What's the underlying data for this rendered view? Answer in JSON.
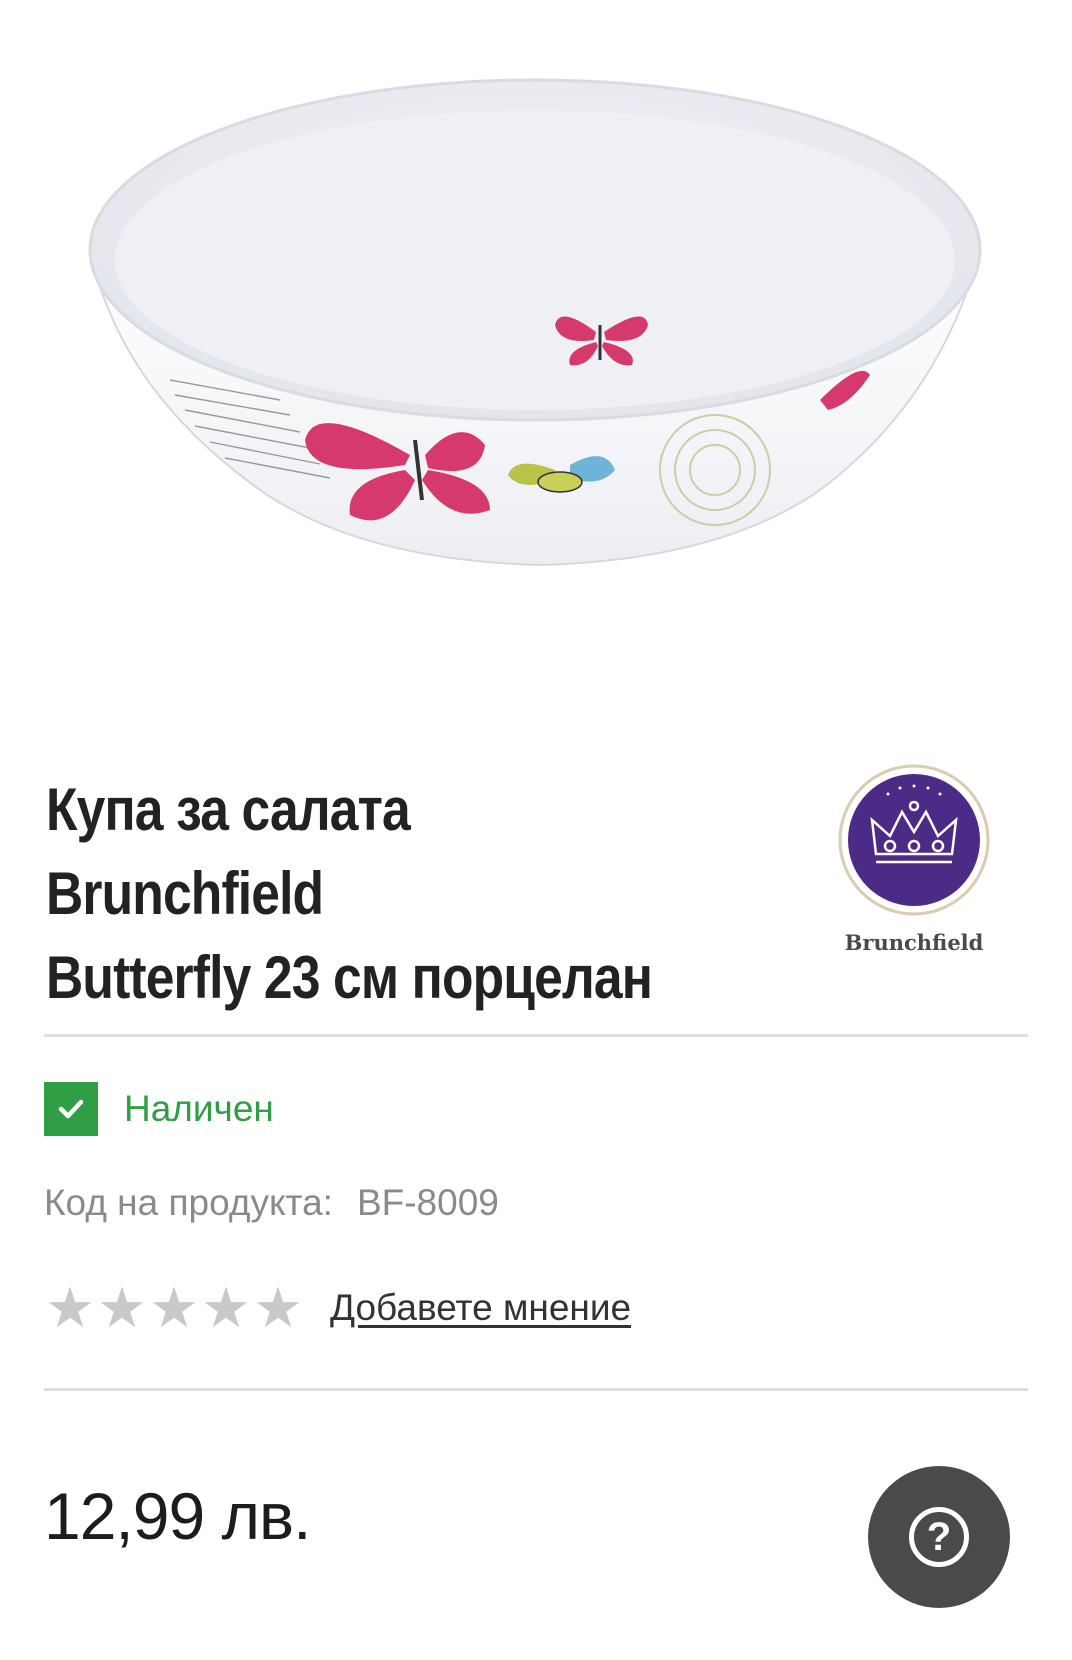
{
  "product": {
    "title_line1": "Купа за салата Brunchfield",
    "title_line2": "Butterfly 23 см порцелан",
    "image_icon": "bowl-product-image",
    "brand_logo_text": "Brunchfield"
  },
  "availability": {
    "label": "Наличен",
    "icon": "check-icon",
    "color": "#2f9e44"
  },
  "sku": {
    "label": "Код на продукта:",
    "value": "BF-8009"
  },
  "rating": {
    "stars_filled": 0,
    "stars_total": 5,
    "review_link": "Добавете мнение"
  },
  "price": {
    "value": "12,99 лв."
  },
  "help": {
    "icon": "question-icon",
    "symbol": "?"
  }
}
